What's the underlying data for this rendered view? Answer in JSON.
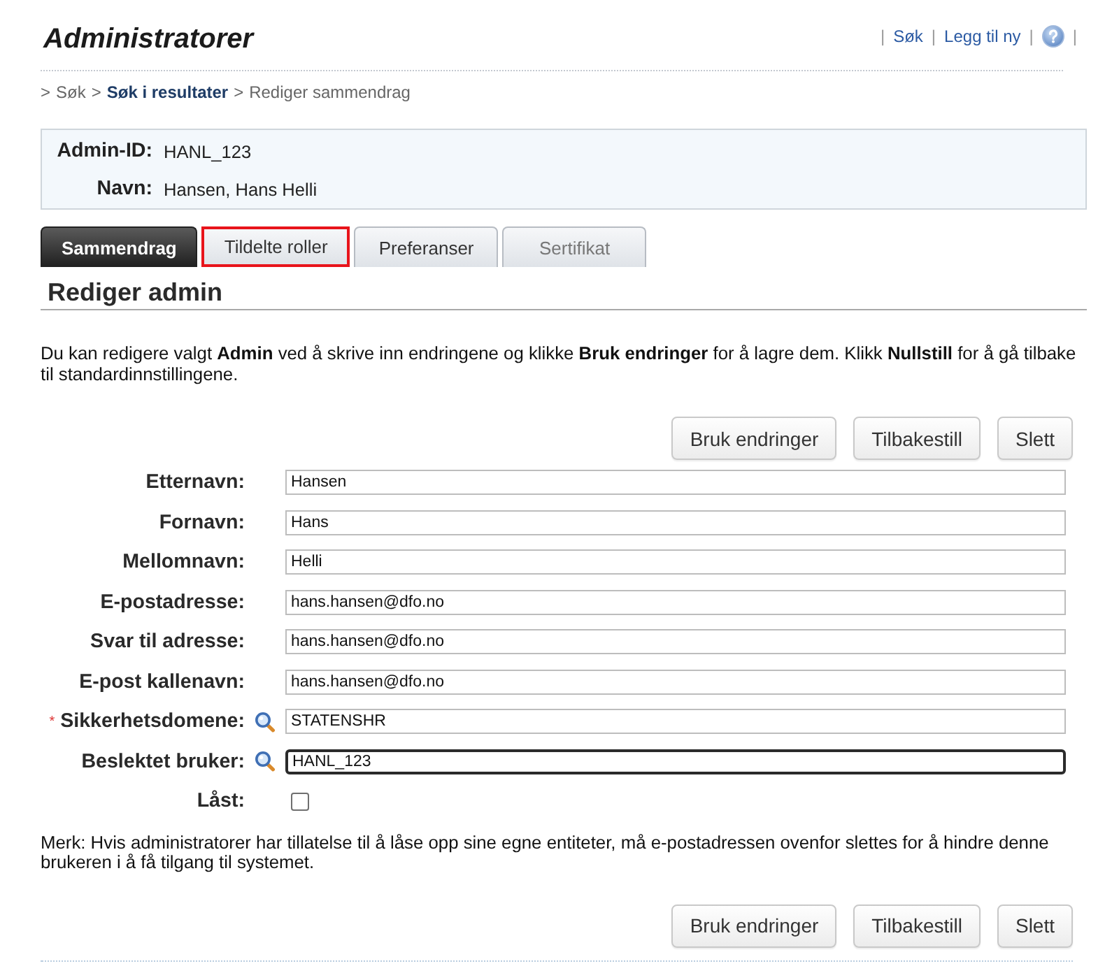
{
  "header": {
    "title": "Administratorer",
    "separator": "|",
    "links": [
      {
        "kind": "link",
        "label": "Søk"
      },
      {
        "kind": "link",
        "label": "Legg til ny"
      },
      {
        "kind": "help"
      }
    ]
  },
  "breadcrumb": {
    "separator": ">",
    "items": [
      {
        "label": "Søk",
        "bold": false
      },
      {
        "label": "Søk i resultater",
        "bold": true
      },
      {
        "label": "Rediger sammendrag",
        "bold": false
      }
    ]
  },
  "summary": [
    {
      "label": "Admin-ID:",
      "value": "HANL_123"
    },
    {
      "label": "Navn:",
      "value": "Hansen, Hans Helli"
    }
  ],
  "tabs": [
    {
      "label": "Sammendrag",
      "selected": true,
      "highlighted": false,
      "disabled": false
    },
    {
      "label": "Tildelte roller",
      "selected": false,
      "highlighted": true,
      "disabled": false
    },
    {
      "label": "Preferanser",
      "selected": false,
      "highlighted": false,
      "disabled": false
    },
    {
      "label": "Sertifikat",
      "selected": false,
      "highlighted": false,
      "disabled": true
    }
  ],
  "section": {
    "heading": "Rediger admin",
    "intro": "Du kan redigere valgt **Admin** ved å skrive inn endringene og klikke **Bruk endringer** for å lagre dem. Klikk **Nullstill** for å gå tilbake til standardinnstillingene."
  },
  "actions_top": [
    "Bruk endringer",
    "Tilbakestill",
    "Slett"
  ],
  "form": {
    "required_mark": "*",
    "fields": [
      {
        "kind": "text",
        "label": "Etternavn:",
        "value": "Hansen",
        "required": false,
        "lookup": false,
        "focused": false
      },
      {
        "kind": "text",
        "label": "Fornavn:",
        "value": "Hans",
        "required": false,
        "lookup": false,
        "focused": false
      },
      {
        "kind": "text",
        "label": "Mellomnavn:",
        "value": "Helli",
        "required": false,
        "lookup": false,
        "focused": false
      },
      {
        "kind": "text",
        "label": "E-postadresse:",
        "value": "hans.hansen@dfo.no",
        "required": false,
        "lookup": false,
        "focused": false
      },
      {
        "kind": "text",
        "label": "Svar til adresse:",
        "value": "hans.hansen@dfo.no",
        "required": false,
        "lookup": false,
        "focused": false
      },
      {
        "kind": "text",
        "label": "E-post kallenavn:",
        "value": "hans.hansen@dfo.no",
        "required": false,
        "lookup": false,
        "focused": false
      },
      {
        "kind": "text",
        "label": "Sikkerhetsdomene:",
        "value": "STATENSHR",
        "required": true,
        "lookup": true,
        "focused": false
      },
      {
        "kind": "text",
        "label": "Beslektet bruker:",
        "value": "HANL_123",
        "required": false,
        "lookup": true,
        "focused": true
      },
      {
        "kind": "checkbox",
        "label": "Låst:",
        "checked": false,
        "required": false,
        "lookup": false
      }
    ]
  },
  "note": "Merk: Hvis administratorer har tillatelse til å låse opp sine egne entiteter, må e-postadressen ovenfor slettes for å hindre denne brukeren i å få tilgang til systemet.",
  "actions_bottom": [
    "Bruk endringer",
    "Tilbakestill",
    "Slett"
  ]
}
